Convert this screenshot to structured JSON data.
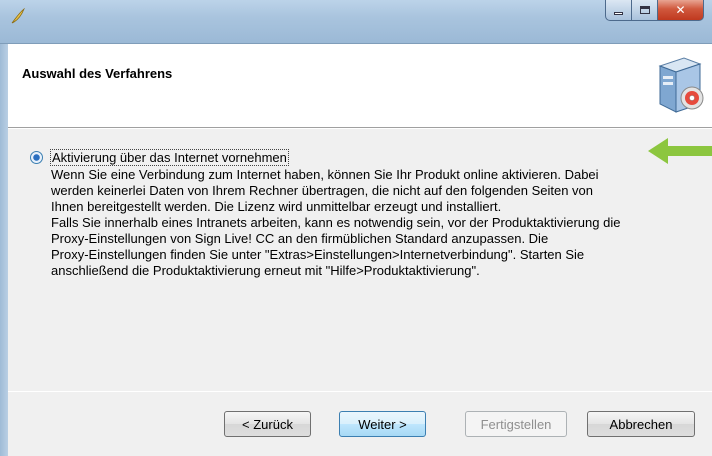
{
  "window": {
    "colors": {
      "accent": "#3c7fb1",
      "close": "#c0391f",
      "arrow": "#8cc63f"
    }
  },
  "header": {
    "title": "Auswahl des Verfahrens",
    "icon": "installer-box-icon"
  },
  "option": {
    "label": "Aktivierung über das Internet vornehmen",
    "selected": true,
    "description": "Wenn Sie eine Verbindung zum Internet haben, können Sie Ihr Produkt online aktivieren. Dabei\nwerden keinerlei Daten von Ihrem Rechner übertragen, die nicht auf den folgenden Seiten von\nIhnen bereitgestellt werden. Die Lizenz wird unmittelbar erzeugt und installiert.\nFalls Sie innerhalb eines Intranets arbeiten, kann es notwendig sein, vor der Produktaktivierung die\nProxy-Einstellungen von Sign Live! CC an den firmüblichen Standard anzupassen. Die\nProxy-Einstellungen finden Sie unter \"Extras>Einstellungen>Internetverbindung\". Starten Sie\nanschließend die Produktaktivierung erneut mit \"Hilfe>Produktaktivierung\"."
  },
  "buttons": {
    "back": "< Zurück",
    "next": "Weiter >",
    "finish": "Fertigstellen",
    "cancel": "Abbrechen"
  }
}
